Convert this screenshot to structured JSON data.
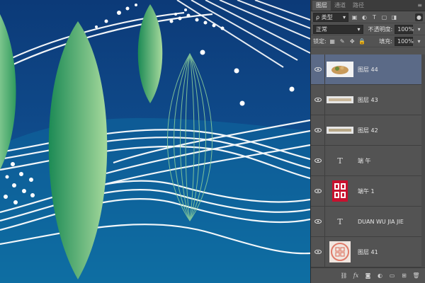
{
  "panel": {
    "tabs": [
      "图层",
      "通道",
      "路径"
    ],
    "filter_label": "ρ 类型",
    "blend_mode": "正常",
    "opacity_label": "不透明度:",
    "opacity_value": "100%",
    "lock_label": "锁定:",
    "fill_label": "填充:",
    "fill_value": "100%"
  },
  "layers": [
    {
      "name": "图层 44",
      "kind": "image",
      "selected": true
    },
    {
      "name": "图层 43",
      "kind": "image",
      "selected": false
    },
    {
      "name": "图层 42",
      "kind": "image",
      "selected": false
    },
    {
      "name": "端 午",
      "kind": "text",
      "selected": false
    },
    {
      "name": "端午 1",
      "kind": "seal",
      "selected": false
    },
    {
      "name": "DUAN WU JIA JIE",
      "kind": "text",
      "selected": false
    },
    {
      "name": "图层 41",
      "kind": "stamp",
      "selected": false
    }
  ],
  "colors": {
    "canvas_top": "#0d3d7a",
    "canvas_bottom": "#0f6a9e",
    "leaf_light": "#8fd29a",
    "leaf_dark": "#1a8a52",
    "panel_bg": "#535353",
    "selected_layer": "#5b6a87"
  }
}
